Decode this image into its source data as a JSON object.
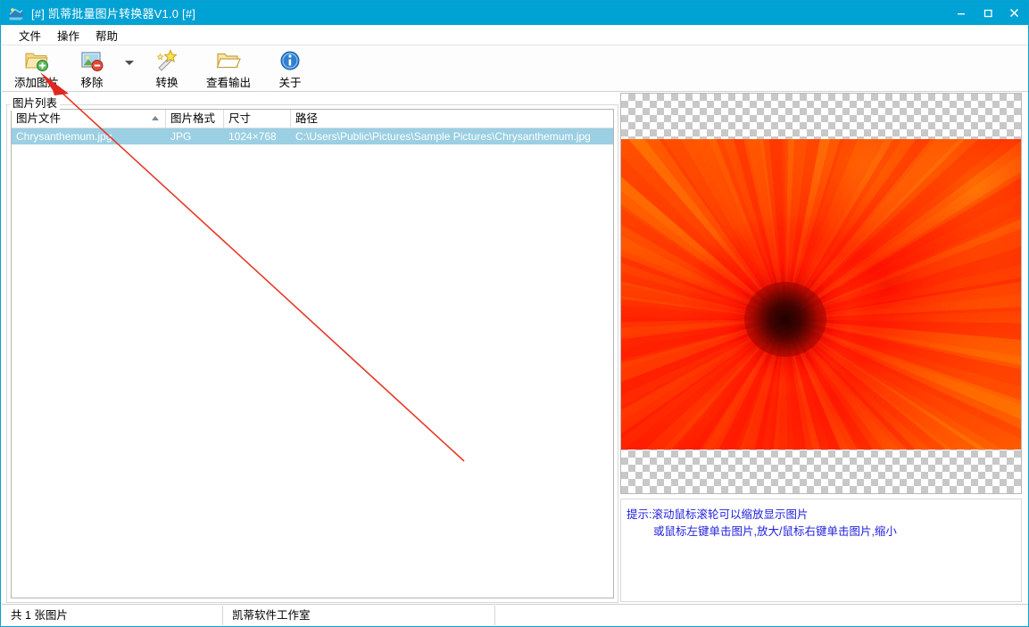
{
  "window": {
    "title": "[#] 凯蒂批量图片转换器V1.0 [#]",
    "app_icon": "app-converter-icon",
    "controls": {
      "minimize": "—",
      "maximize": "❐",
      "close": "✕"
    },
    "accent_color": "#00a2d4"
  },
  "menu": {
    "items": [
      {
        "label": "文件"
      },
      {
        "label": "操作"
      },
      {
        "label": "帮助"
      }
    ]
  },
  "toolbar": {
    "buttons": [
      {
        "label": "添加图片",
        "icon": "folder-add-icon"
      },
      {
        "label": "移除",
        "icon": "image-remove-icon"
      },
      {
        "label": "转换",
        "icon": "magic-wand-icon"
      },
      {
        "label": "查看输出",
        "icon": "folder-open-icon"
      },
      {
        "label": "关于",
        "icon": "info-icon"
      }
    ],
    "dropdown_icon": "chevron-down-icon"
  },
  "list_panel": {
    "group_label": "图片列表",
    "columns": [
      {
        "label": "图片文件",
        "sorted": "asc"
      },
      {
        "label": "图片格式"
      },
      {
        "label": "尺寸"
      },
      {
        "label": "路径"
      }
    ],
    "rows": [
      {
        "file": "Chrysanthemum.jpg",
        "format": "JPG",
        "size": "1024×768",
        "path": "C:\\Users\\Public\\Pictures\\Sample Pictures\\Chrysanthemum.jpg",
        "selected": true
      }
    ],
    "selection_color": "#9bcfe3"
  },
  "preview": {
    "image_name": "Chrysanthemum.jpg",
    "background": "transparency-checkerboard"
  },
  "hint": {
    "line1": "提示:滚动鼠标滚轮可以缩放显示图片",
    "line2": "或鼠标左键单击图片,放大/鼠标右键单击图片,缩小",
    "color": "#2222dd"
  },
  "status": {
    "count_text": "共 1 张图片",
    "brand_text": "凯蒂软件工作室",
    "extra_text": ""
  },
  "annotation": {
    "type": "red-arrow",
    "color": "#e02020",
    "points_to": "添加图片"
  }
}
